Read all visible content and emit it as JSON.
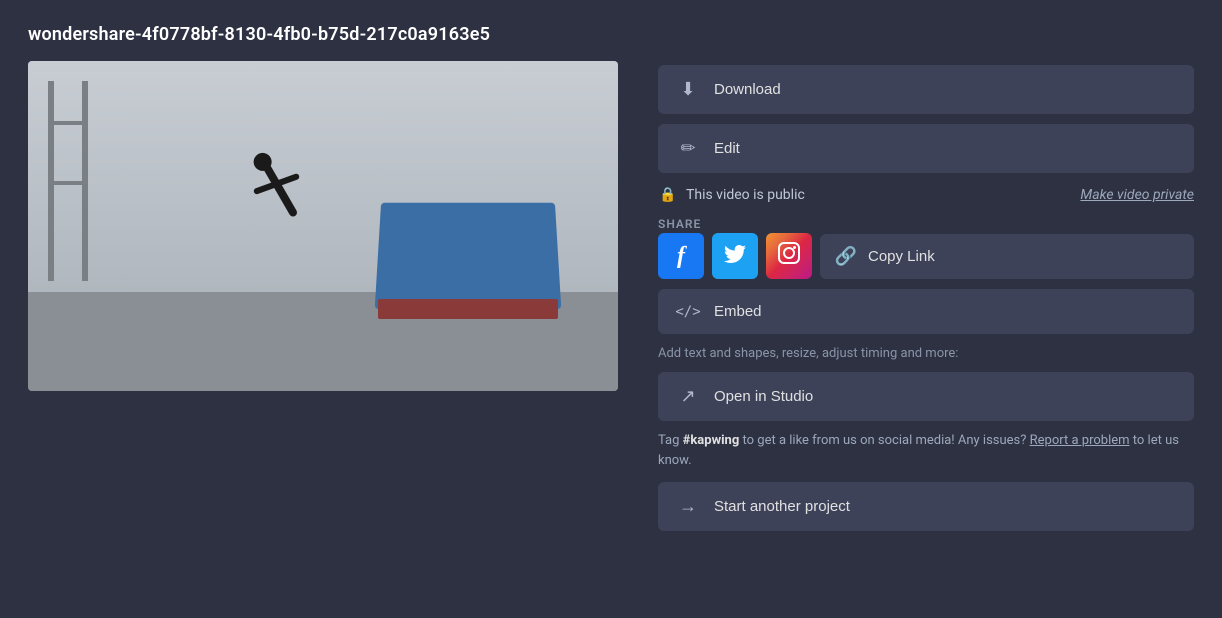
{
  "page": {
    "title": "wondershare-4f0778bf-8130-4fb0-b75d-217c0a9163e5"
  },
  "buttons": {
    "download": "Download",
    "edit": "Edit",
    "embed": "Embed",
    "copy_link": "Copy Link",
    "open_in_studio": "Open in Studio",
    "start_another_project": "Start another project"
  },
  "privacy": {
    "status": "This video is public",
    "make_private_link": "Make video private"
  },
  "share": {
    "label": "SHARE"
  },
  "helper": {
    "studio_description": "Add text and shapes, resize, adjust timing and more:",
    "social_promo": "Tag",
    "hashtag": "#kapwing",
    "social_promo_mid": "to get a like from us on social media! Any issues?",
    "report_link": "Report a problem",
    "social_promo_end": "to let us know."
  },
  "icons": {
    "download": "⬇",
    "edit": "✏",
    "lock": "🔒",
    "link": "🔗",
    "embed": "</>",
    "external": "↗",
    "arrow": "→",
    "facebook": "f",
    "twitter": "t",
    "instagram": "ig"
  }
}
